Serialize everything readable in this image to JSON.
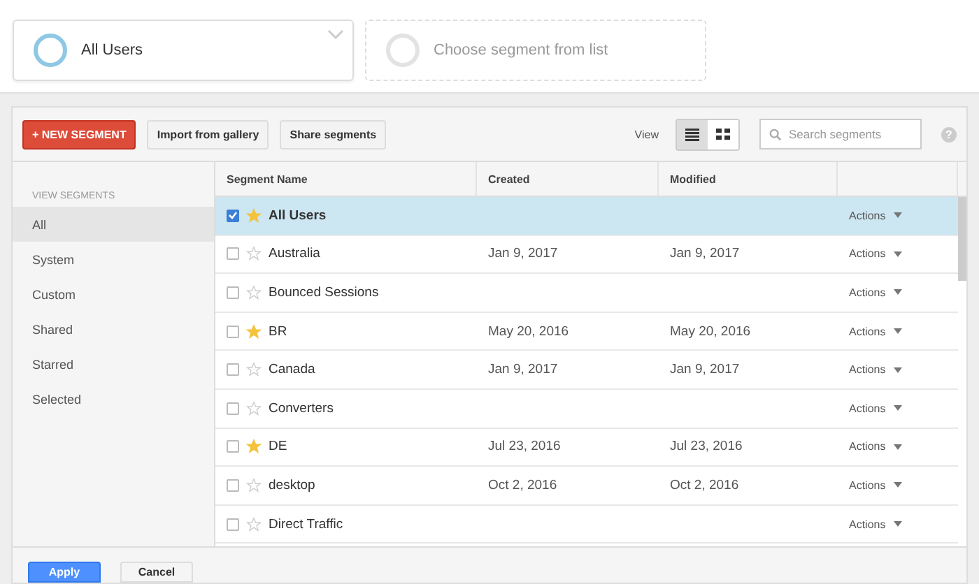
{
  "segment_slots": [
    {
      "label": "All Users",
      "filled": true
    },
    {
      "label": "Choose segment from list",
      "filled": false
    }
  ],
  "toolbar": {
    "new_button": "+ NEW SEGMENT",
    "buttons": [
      "Import from gallery",
      "Share segments"
    ],
    "view_label": "View",
    "views": [
      {
        "kind": "list",
        "selected": true
      },
      {
        "kind": "grid",
        "selected": false
      }
    ],
    "search": {
      "placeholder": "Search segments"
    },
    "help": "?"
  },
  "sidebar": {
    "heading": "VIEW SEGMENTS",
    "items": [
      {
        "label": "All",
        "selected": true
      },
      {
        "label": "System",
        "selected": false
      },
      {
        "label": "Custom",
        "selected": false
      },
      {
        "label": "Shared",
        "selected": false
      },
      {
        "label": "Starred",
        "selected": false
      },
      {
        "label": "Selected",
        "selected": false
      }
    ]
  },
  "table": {
    "columns": [
      "Segment Name",
      "Created",
      "Modified"
    ],
    "rows": [
      {
        "checked": true,
        "starred": true,
        "name": "All Users",
        "created": "",
        "modified": "",
        "actions": "Actions"
      },
      {
        "checked": false,
        "starred": false,
        "name": "Australia",
        "created": "Jan 9, 2017",
        "modified": "Jan 9, 2017",
        "actions": "Actions"
      },
      {
        "checked": false,
        "starred": false,
        "name": "Bounced Sessions",
        "created": "",
        "modified": "",
        "actions": "Actions"
      },
      {
        "checked": false,
        "starred": true,
        "name": "BR",
        "created": "May 20, 2016",
        "modified": "May 20, 2016",
        "actions": "Actions"
      },
      {
        "checked": false,
        "starred": false,
        "name": "Canada",
        "created": "Jan 9, 2017",
        "modified": "Jan 9, 2017",
        "actions": "Actions"
      },
      {
        "checked": false,
        "starred": false,
        "name": "Converters",
        "created": "",
        "modified": "",
        "actions": "Actions"
      },
      {
        "checked": false,
        "starred": true,
        "name": "DE",
        "created": "Jul 23, 2016",
        "modified": "Jul 23, 2016",
        "actions": "Actions"
      },
      {
        "checked": false,
        "starred": false,
        "name": "desktop",
        "created": "Oct 2, 2016",
        "modified": "Oct 2, 2016",
        "actions": "Actions"
      },
      {
        "checked": false,
        "starred": false,
        "name": "Direct Traffic",
        "created": "",
        "modified": "",
        "actions": "Actions"
      }
    ]
  },
  "footer": {
    "apply": "Apply",
    "cancel": "Cancel"
  }
}
